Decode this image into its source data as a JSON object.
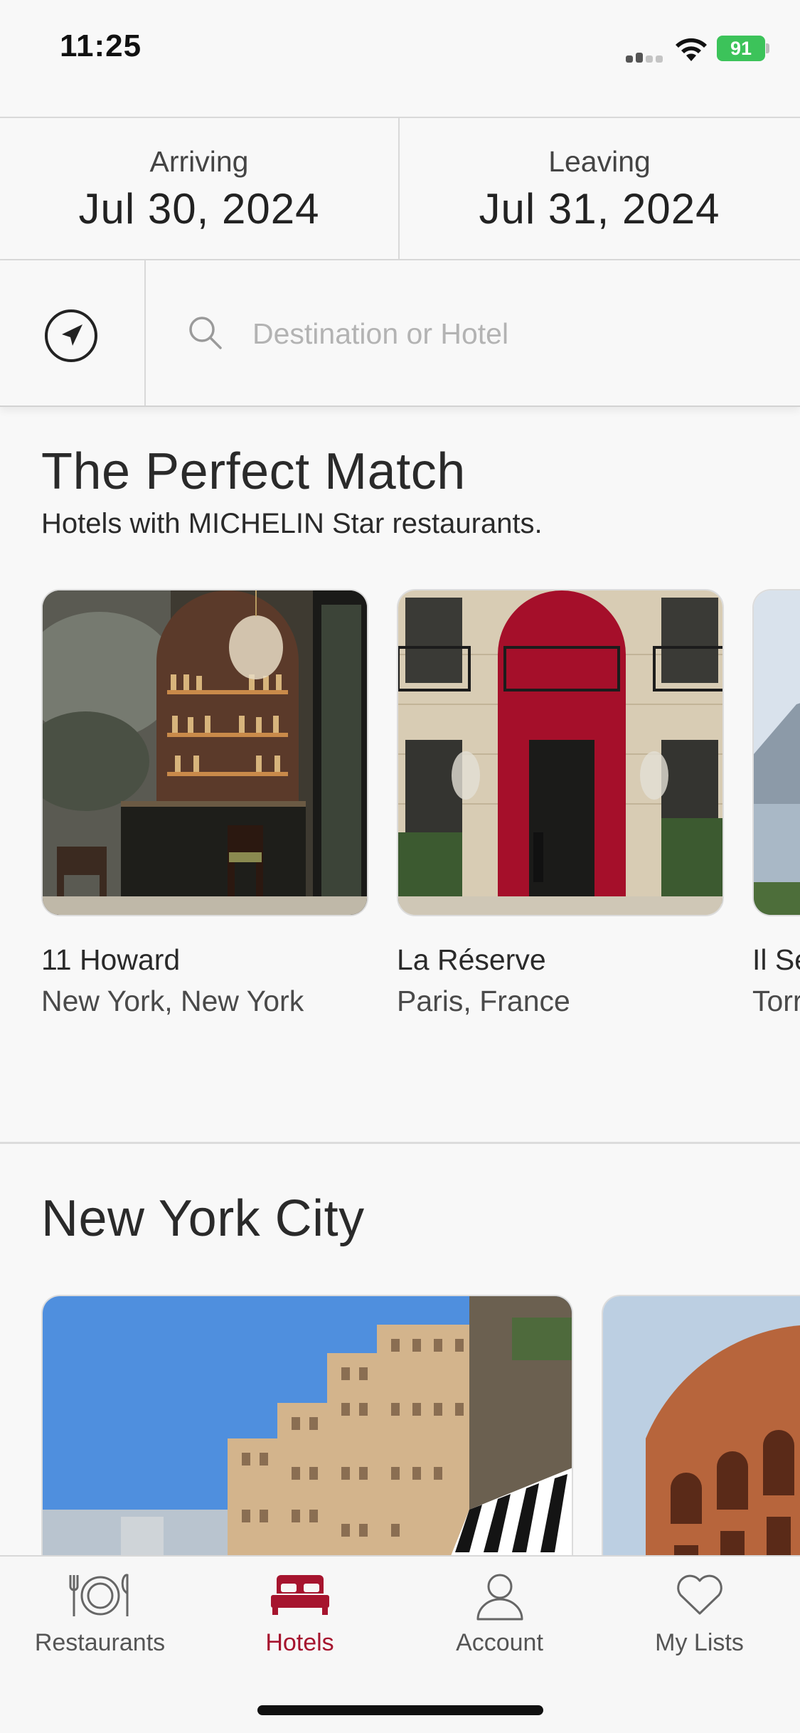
{
  "status_bar": {
    "time": "11:25",
    "battery": "91"
  },
  "dates": {
    "arriving_label": "Arriving",
    "arriving_value": "Jul 30, 2024",
    "leaving_label": "Leaving",
    "leaving_value": "Jul 31, 2024"
  },
  "search": {
    "placeholder": "Destination or Hotel",
    "value": ""
  },
  "perfect_match": {
    "title": "The Perfect Match",
    "subtitle": "Hotels with MICHELIN Star restaurants.",
    "cards": [
      {
        "name": "11 Howard",
        "location": "New York, New York"
      },
      {
        "name": "La Réserve",
        "location": "Paris, France"
      },
      {
        "name": "Il Se",
        "location": "Torr"
      }
    ]
  },
  "city_section": {
    "title": "New York City"
  },
  "tabs": [
    {
      "label": "Restaurants",
      "icon": "plate-icon"
    },
    {
      "label": "Hotels",
      "icon": "bed-icon",
      "active": true
    },
    {
      "label": "Account",
      "icon": "person-icon"
    },
    {
      "label": "My Lists",
      "icon": "heart-icon"
    }
  ],
  "colors": {
    "accent": "#a6142e",
    "battery": "#3cc35a",
    "background": "#f8f8f8"
  }
}
